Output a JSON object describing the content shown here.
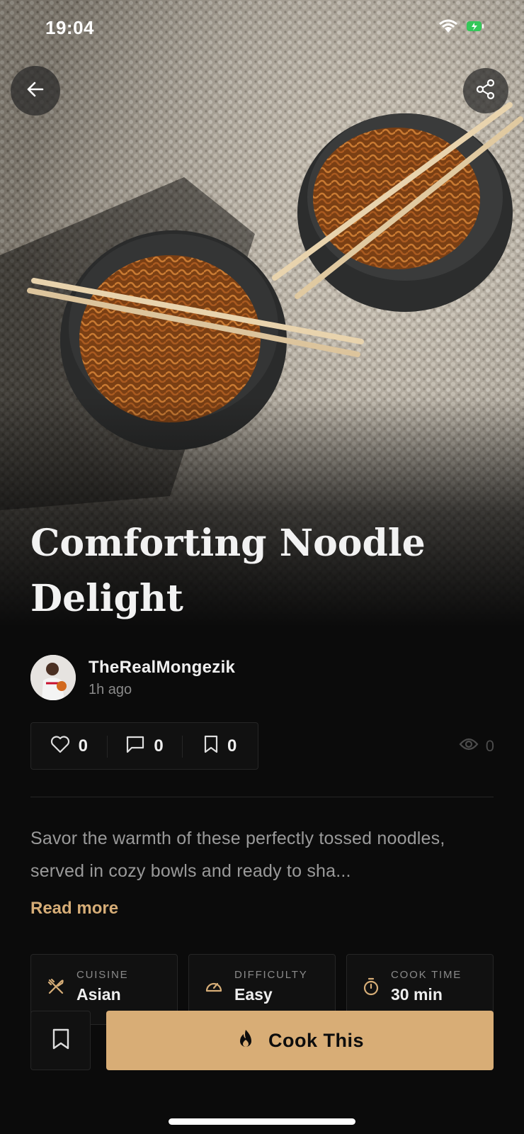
{
  "status_bar": {
    "time": "19:04"
  },
  "header": {
    "back_icon": "arrow-left-icon",
    "share_icon": "share-icon"
  },
  "recipe": {
    "title": "Comforting Noodle Delight",
    "author": {
      "name": "TheRealMongezik",
      "posted": "1h ago"
    },
    "stats": {
      "likes": "0",
      "comments": "0",
      "saves": "0",
      "views": "0"
    },
    "description": "Savor the warmth of these perfectly tossed noodles, served in cozy bowls and ready to sha...",
    "read_more": "Read more",
    "meta": [
      {
        "label": "CUISINE",
        "value": "Asian",
        "icon": "utensils-icon"
      },
      {
        "label": "DIFFICULTY",
        "value": "Easy",
        "icon": "gauge-icon"
      },
      {
        "label": "COOK TIME",
        "value": "30 min",
        "icon": "timer-icon"
      }
    ]
  },
  "actions": {
    "cook_label": "Cook This",
    "cook_icon": "flame-icon",
    "save_icon": "bookmark-icon"
  },
  "colors": {
    "accent": "#D8AD76",
    "background": "#0B0B0B",
    "card": "#111111",
    "border": "#262626"
  }
}
